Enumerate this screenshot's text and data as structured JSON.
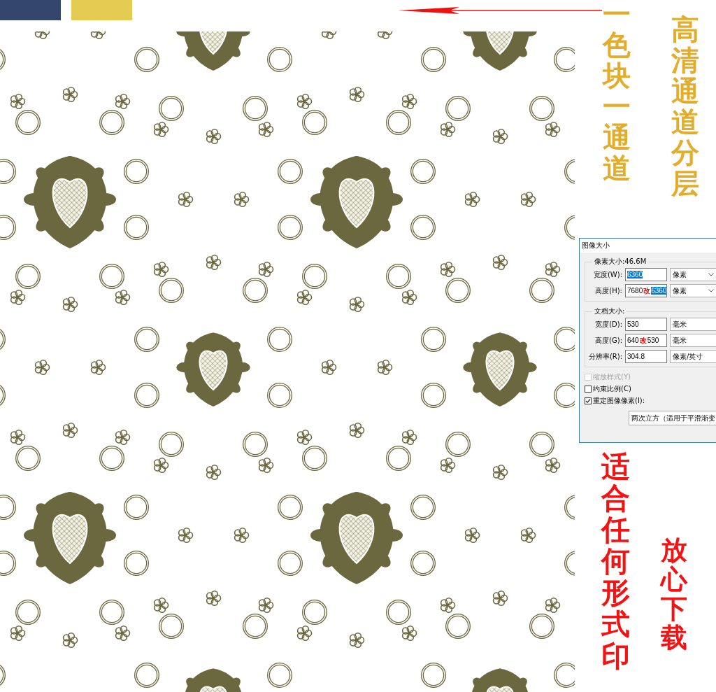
{
  "swatches": [
    {
      "color": "#35466e"
    },
    {
      "color": "#e4cb52"
    }
  ],
  "captions": [
    {
      "text": "一色块一通道",
      "color": "#e2ad2c"
    },
    {
      "text": "高清通道分层",
      "color": "#e2ad2c"
    },
    {
      "text": "适合任何形式印",
      "color": "#f01414"
    },
    {
      "text": "放心下载",
      "color": "#f01414"
    }
  ],
  "dialog": {
    "title": "图像大小",
    "groups": [
      {
        "legend": "像素大小:46.6M",
        "unit_dropdowns": true,
        "rows": [
          {
            "label": "宽度(W):",
            "value": "6360",
            "highlighted": true,
            "unit": "像素"
          },
          {
            "label": "高度(H):",
            "value": "7680",
            "annotation": "改",
            "correction": "6360",
            "highlighted": true,
            "unit": "像素"
          }
        ]
      },
      {
        "legend": "文档大小:",
        "unit_dropdowns": false,
        "rows": [
          {
            "label": "宽度(D):",
            "value": "530",
            "highlighted": false,
            "unit": "毫米"
          },
          {
            "label": "高度(G):",
            "value": "640",
            "annotation": "改",
            "correction": "530",
            "highlighted": false,
            "unit": "毫米"
          },
          {
            "label": "分辨率(R):",
            "value": "304.8",
            "highlighted": false,
            "unit": "像素/英寸"
          }
        ]
      }
    ],
    "checkboxes": [
      {
        "label": "缩放样式(Y)",
        "checked": false,
        "disabled": true
      },
      {
        "label": "约束比例(C)",
        "checked": false,
        "disabled": false
      },
      {
        "label": "重定图像像素(I):",
        "checked": true,
        "disabled": false
      }
    ],
    "resample": "两次立方（适用于平滑渐变"
  }
}
